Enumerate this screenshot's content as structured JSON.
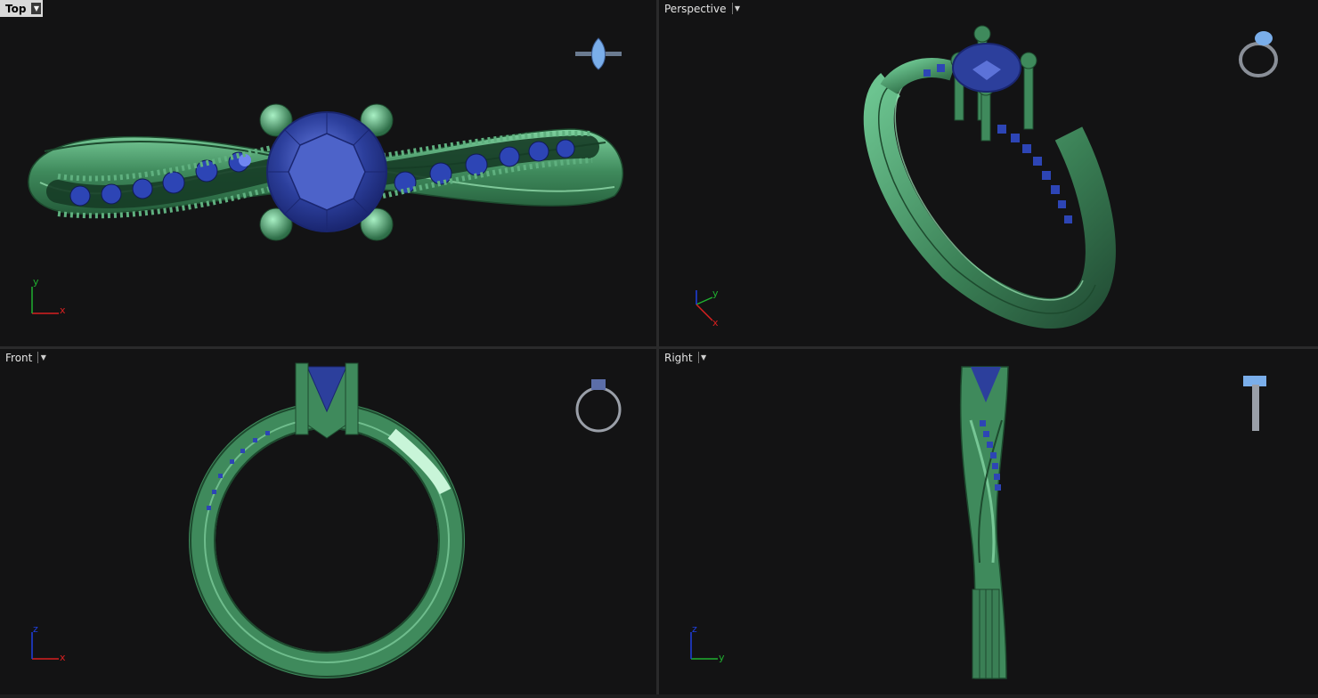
{
  "viewports": {
    "top": {
      "label": "Top",
      "axis_x": "x",
      "axis_y": "y"
    },
    "perspective": {
      "label": "Perspective",
      "axis_x": "x",
      "axis_y": "y"
    },
    "front": {
      "label": "Front",
      "axis_x": "x",
      "axis_y": "z"
    },
    "right": {
      "label": "Right",
      "axis_x": "y",
      "axis_y": "z"
    }
  },
  "colors": {
    "background": "#131314",
    "metal": "#3f8a5c",
    "metal_highlight": "#8fe0ae",
    "gem": "#2c3f9c",
    "gem_highlight": "#5c72d8",
    "axis_x": "#d82020",
    "axis_y": "#20b030",
    "axis_z": "#2040e0"
  },
  "icons": {
    "dropdown": "triangle-down",
    "nav_thumbnail": "ring-preview"
  }
}
